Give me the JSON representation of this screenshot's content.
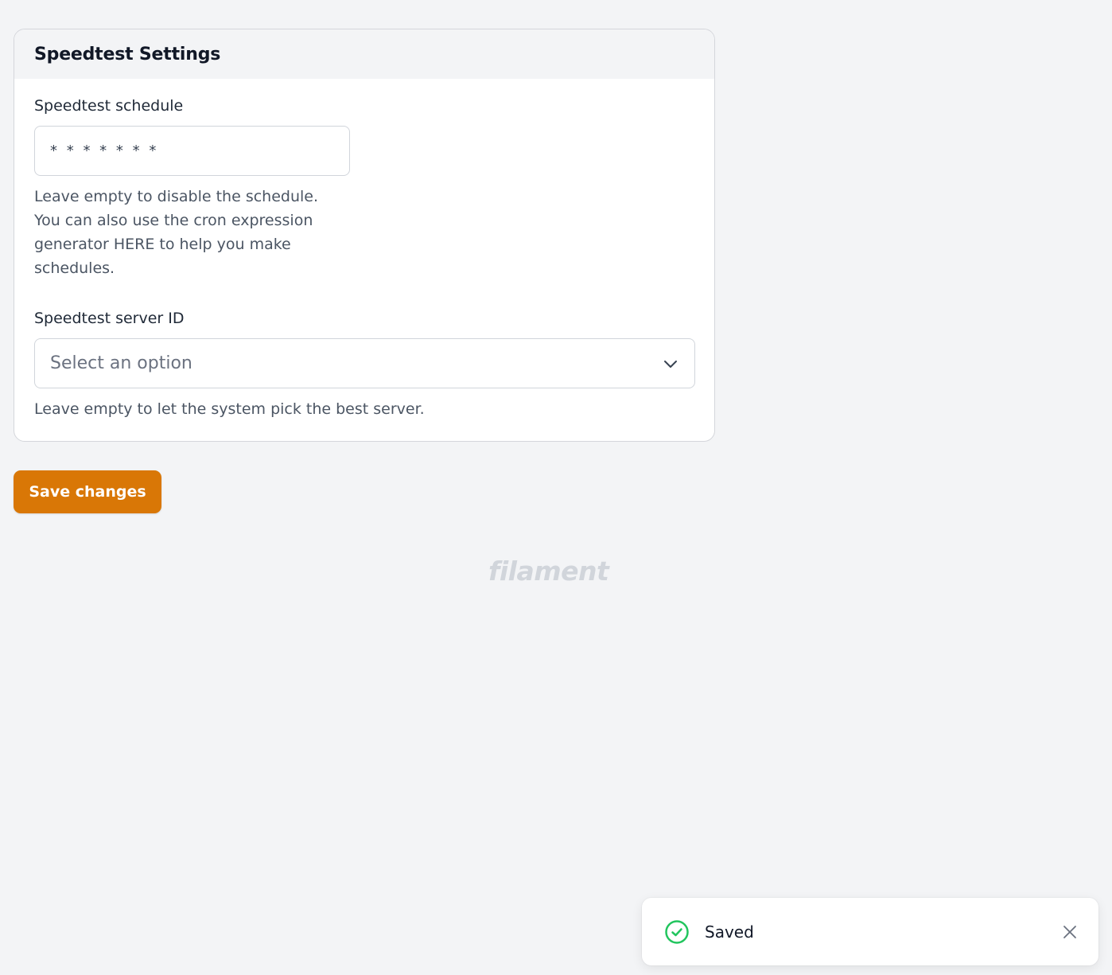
{
  "settings_card": {
    "title": "Speedtest Settings",
    "schedule": {
      "label": "Speedtest schedule",
      "value": "* * * * * * *",
      "helper_text": "Leave empty to disable the schedule. You can also use the cron expression generator HERE to help you make schedules."
    },
    "server": {
      "label": "Speedtest server ID",
      "placeholder": "Select an option",
      "icon": "chevron-down-icon",
      "helper_text": "Leave empty to let the system pick the best server."
    }
  },
  "actions": {
    "save_label": "Save changes"
  },
  "footer": {
    "brand": "filament"
  },
  "toast": {
    "icon": "check-circle-icon",
    "message": "Saved",
    "close_icon": "close-icon"
  },
  "colors": {
    "accent": "#d97706",
    "success": "#22c55e",
    "background": "#f3f4f6"
  }
}
